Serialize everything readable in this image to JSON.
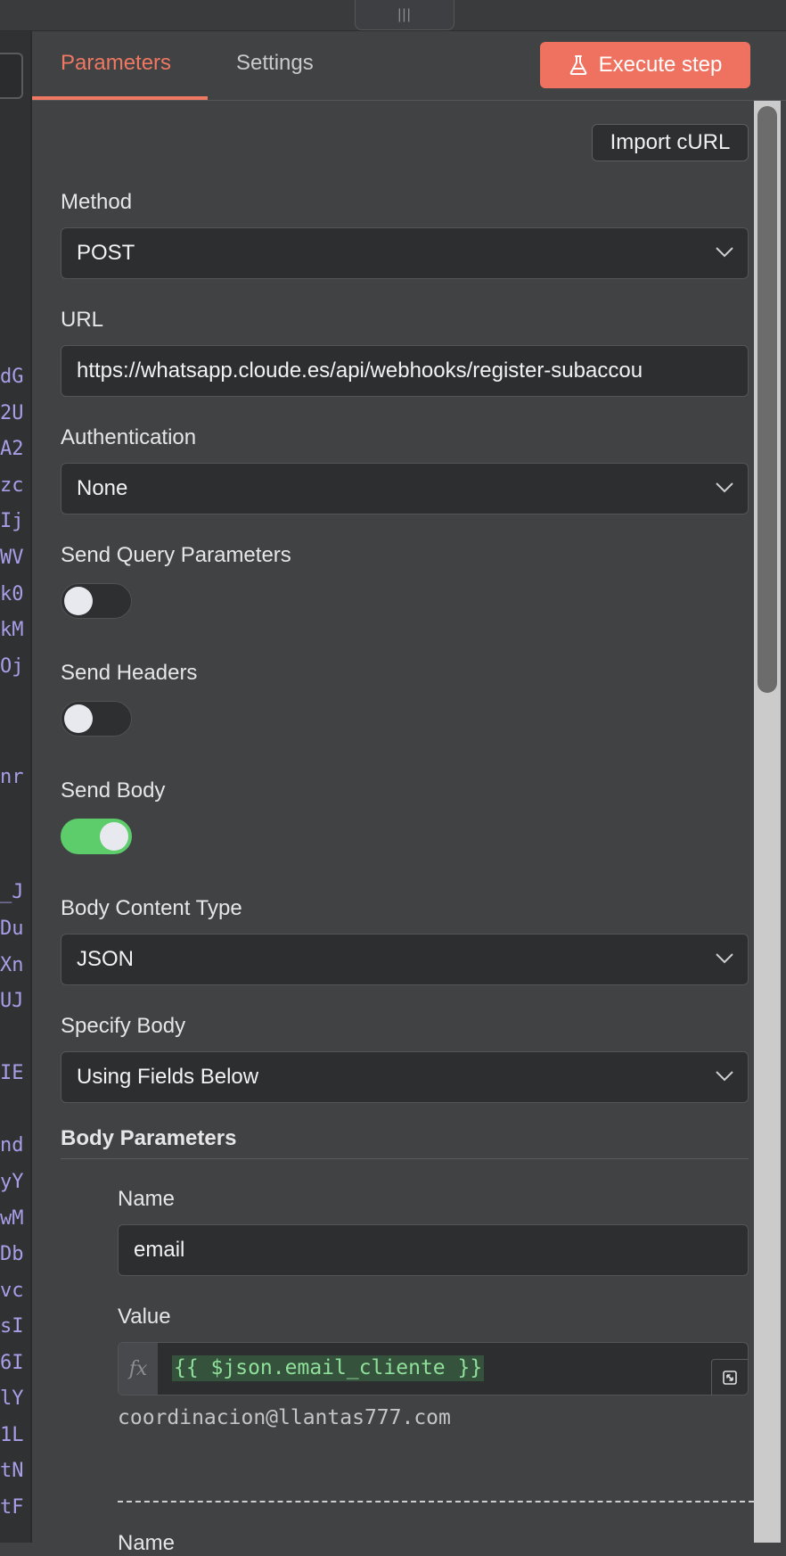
{
  "drag_handle": {
    "glyph": "|||"
  },
  "left_panel": {
    "code_fragments": [
      "dG",
      "2U",
      "A2",
      "zc",
      "Ij",
      "WV",
      "k0",
      "kM",
      "Oj",
      "nr",
      "_J",
      "Du",
      "Xn",
      "UJ",
      "IE",
      "nd",
      "yY",
      "wM",
      "Db",
      "vc",
      "sI",
      "6I",
      "lY",
      "1L",
      "tN",
      "tF"
    ]
  },
  "tabs": {
    "parameters": "Parameters",
    "settings": "Settings",
    "active": "Parameters"
  },
  "execute_button": {
    "label": "Execute step",
    "icon": "flask-icon",
    "color": "#ef7260"
  },
  "import_curl": "Import cURL",
  "method": {
    "label": "Method",
    "value": "POST"
  },
  "url": {
    "label": "URL",
    "value": "https://whatsapp.cloude.es/api/webhooks/register-subaccou"
  },
  "authentication": {
    "label": "Authentication",
    "value": "None"
  },
  "send_query_parameters": {
    "label": "Send Query Parameters",
    "enabled": false
  },
  "send_headers": {
    "label": "Send Headers",
    "enabled": false
  },
  "send_body": {
    "label": "Send Body",
    "enabled": true
  },
  "body_content_type": {
    "label": "Body Content Type",
    "value": "JSON"
  },
  "specify_body": {
    "label": "Specify Body",
    "value": "Using Fields Below"
  },
  "body_parameters": {
    "title": "Body Parameters",
    "items": [
      {
        "name_label": "Name",
        "name_value": "email",
        "value_label": "Value",
        "fx_label": "fx",
        "value_expression": "{{ $json.email_cliente }}",
        "value_preview": "coordinacion@llantas777.com"
      },
      {
        "name_label": "Name"
      }
    ]
  },
  "colors": {
    "accent": "#ee7862",
    "toggle_on": "#5ccd6a",
    "code": "#a79ee8"
  }
}
